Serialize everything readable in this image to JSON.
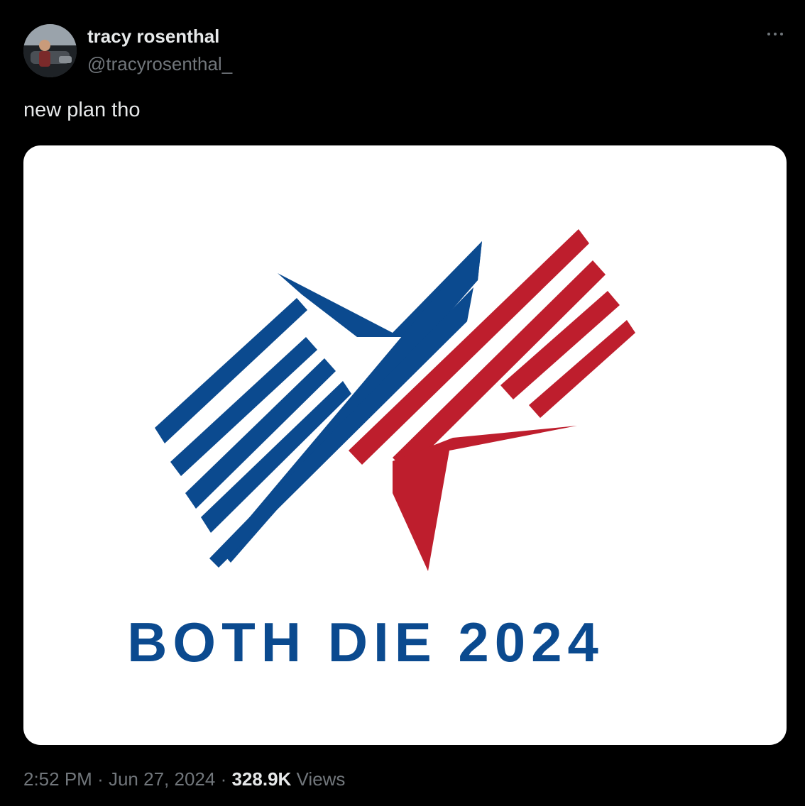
{
  "tweet": {
    "author": {
      "name": "tracy rosenthal",
      "handle": "@tracyrosenthal_",
      "avatar_icon": "profile-photo"
    },
    "more_icon": "more-options-icon",
    "text": "new plan tho",
    "media": {
      "logo_text": "BOTH DIE 2024",
      "colors": {
        "blue": "#0b4a8f",
        "red": "#be1e2d",
        "background": "#ffffff"
      }
    },
    "meta": {
      "time": "2:52 PM",
      "separator": "·",
      "date": "Jun 27, 2024",
      "views_count": "328.9K",
      "views_label": "Views"
    }
  },
  "colors": {
    "background": "#000000",
    "primary_text": "#e7e9ea",
    "secondary_text": "#71767b"
  }
}
